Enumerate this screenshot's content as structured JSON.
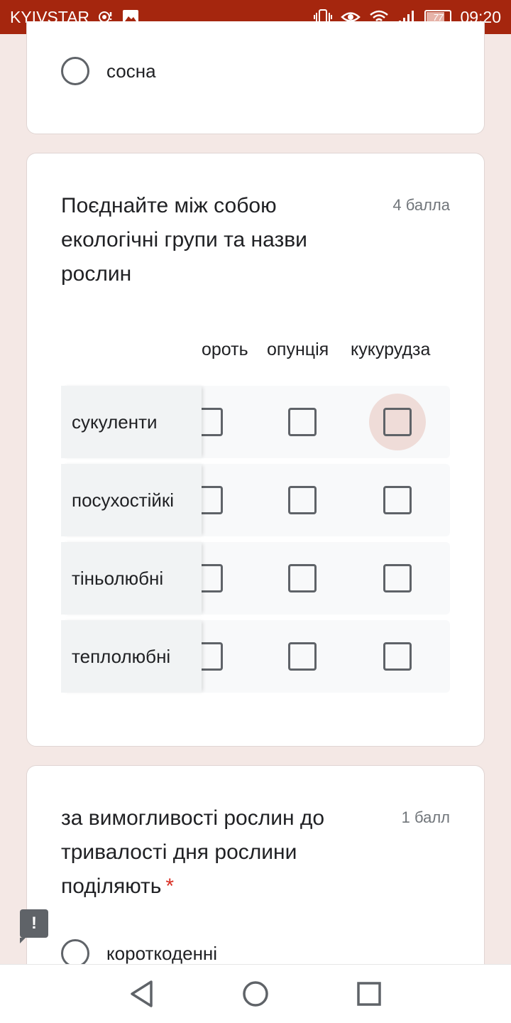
{
  "status_bar": {
    "carrier": "KYIVSTAR",
    "battery": "77",
    "time": "09:20"
  },
  "top_card": {
    "option_label": "сосна"
  },
  "grid_question": {
    "title": "Поєднайте між собою екологічні групи та назви рослин",
    "points": "4 балла",
    "columns": [
      "дуб скороть",
      "опунція",
      "кукурудза"
    ],
    "column_visible_text": [
      "ороть",
      "опунція",
      "кукурудза"
    ],
    "rows": [
      "сукуленти",
      "посухостійкі",
      "тіньолюбні",
      "теплолюбні"
    ]
  },
  "next_question": {
    "title": "за вимогливості рослин до тривалості дня рослини поділяють",
    "required_mark": "*",
    "points": "1 балл",
    "option_label": "короткоденні"
  },
  "colors": {
    "status_bar": "#a5260e",
    "background": "#f4e8e5",
    "ripple": "#efdcd8"
  }
}
